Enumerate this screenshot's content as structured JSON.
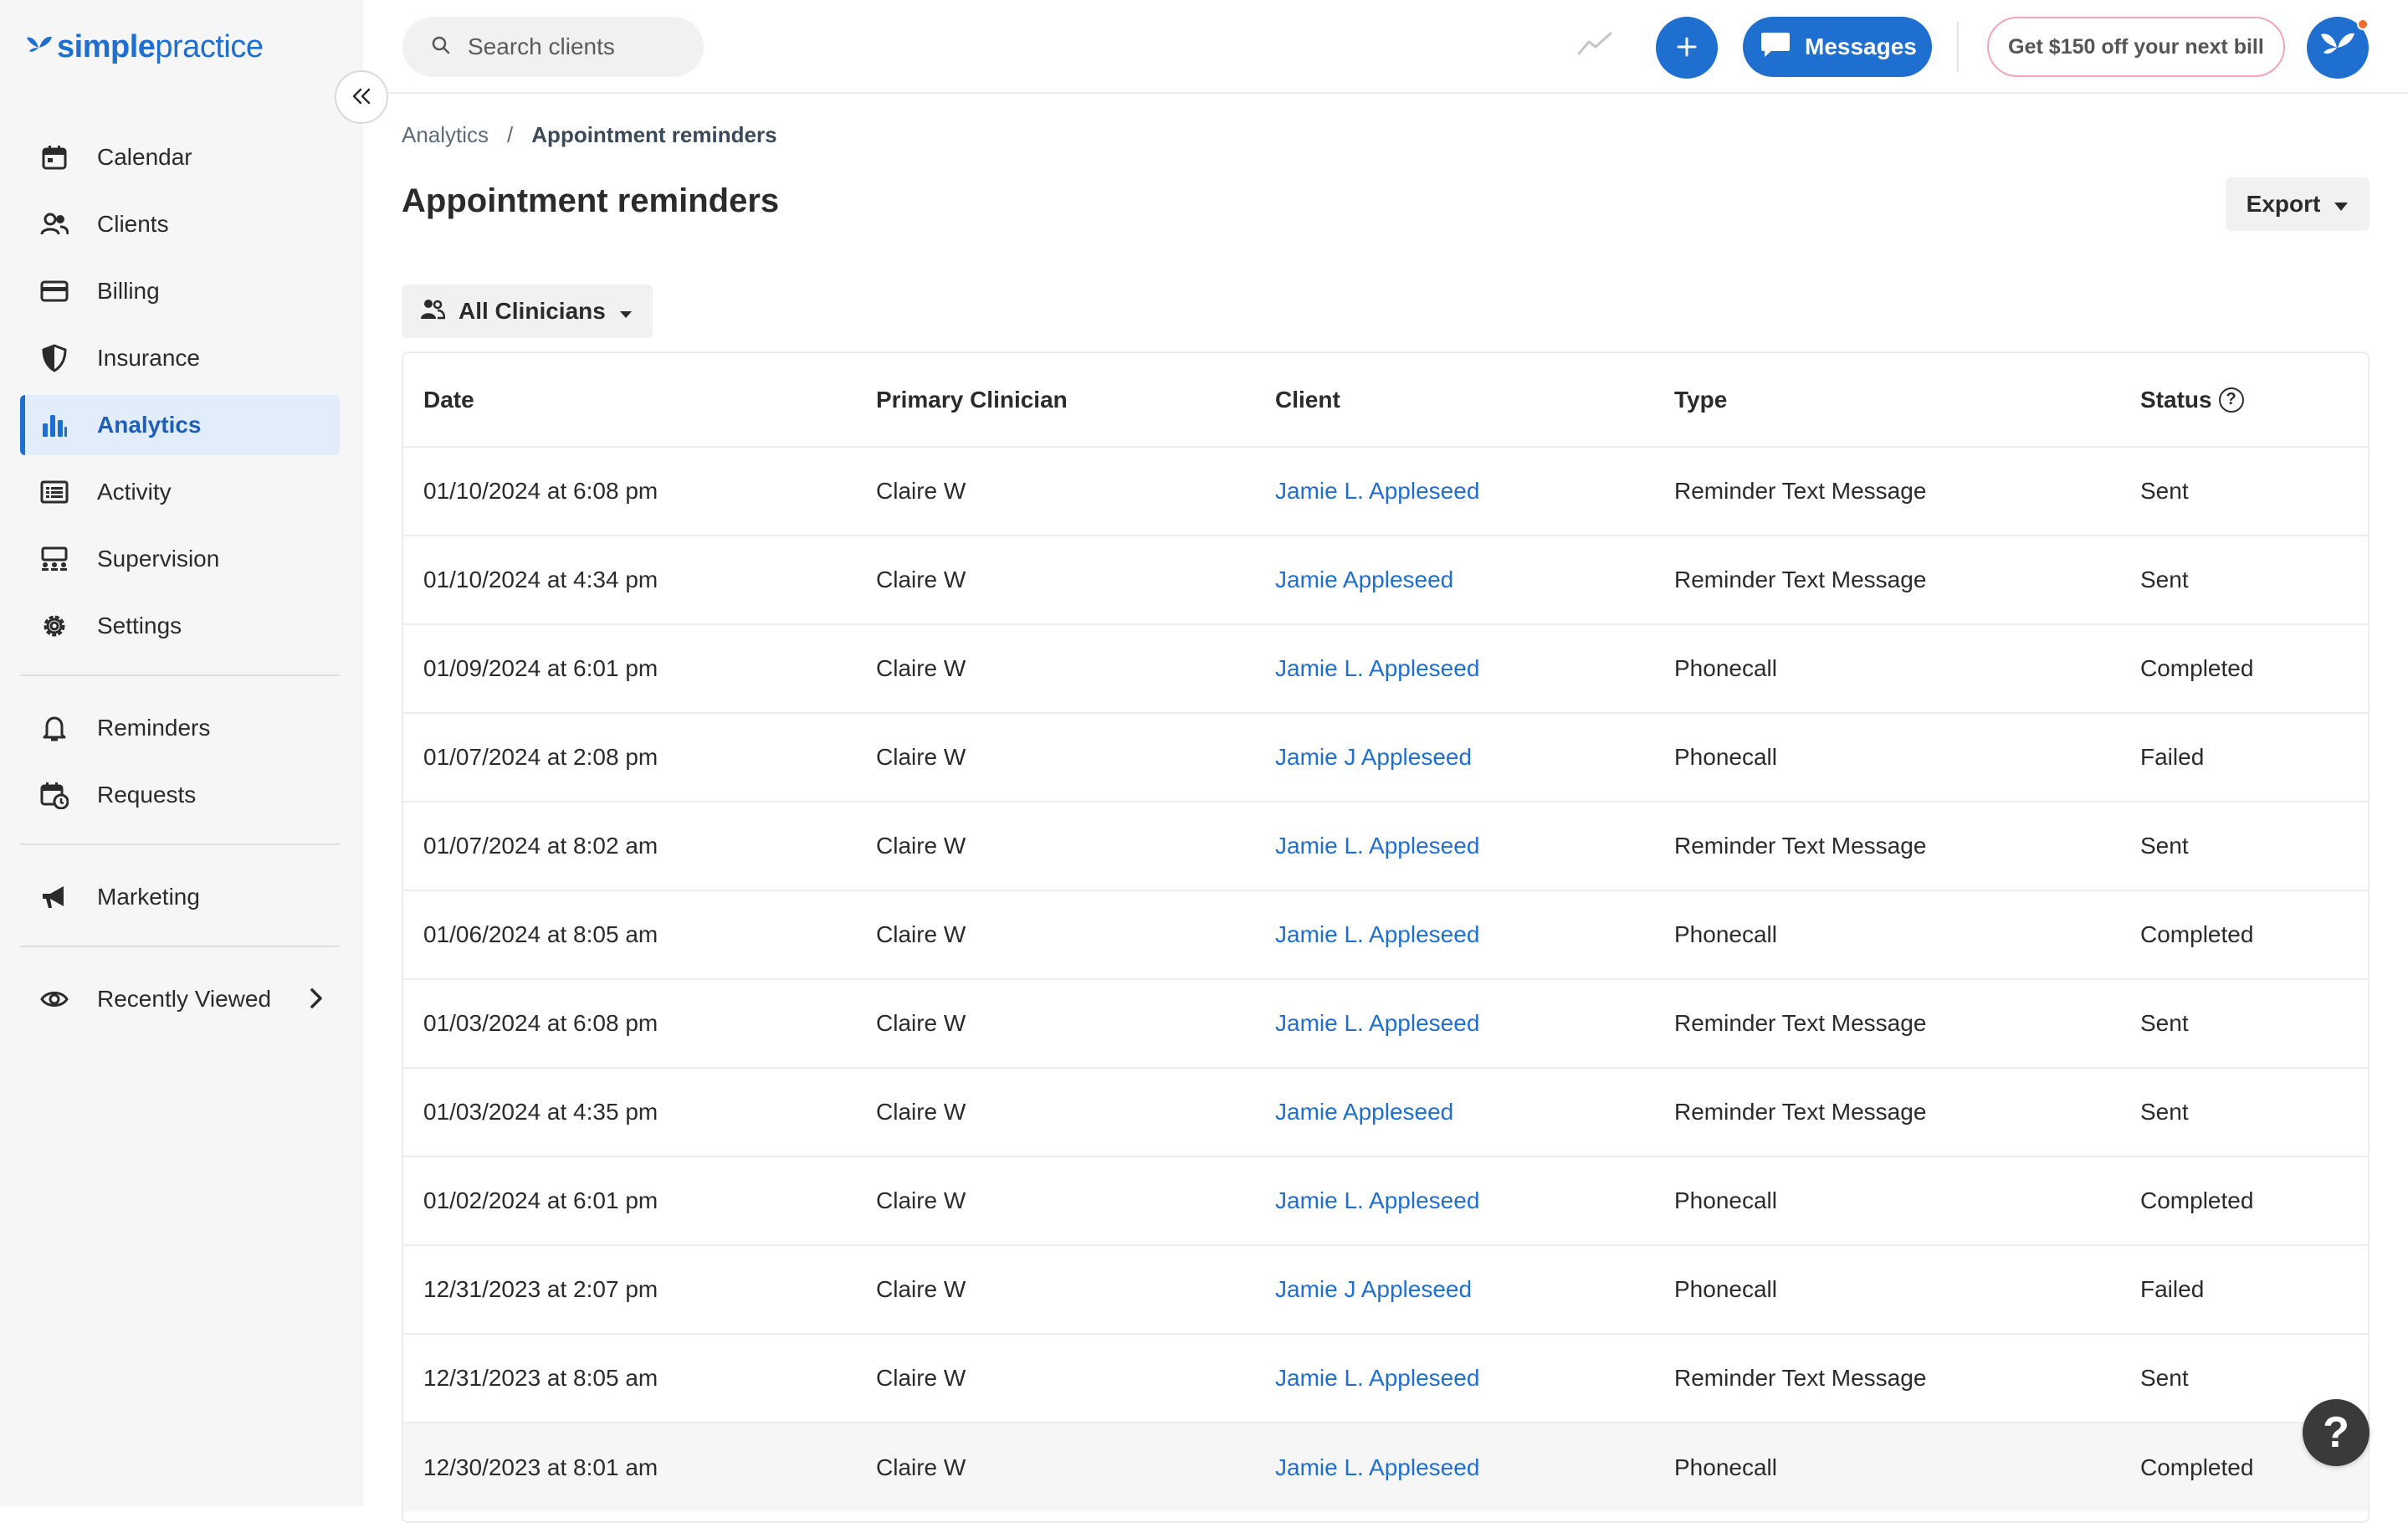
{
  "brand": {
    "simple": "simple",
    "practice": "practice"
  },
  "sidebar": {
    "items": [
      {
        "label": "Calendar",
        "icon": "calendar-icon"
      },
      {
        "label": "Clients",
        "icon": "clients-icon"
      },
      {
        "label": "Billing",
        "icon": "credit-card-icon"
      },
      {
        "label": "Insurance",
        "icon": "shield-icon"
      },
      {
        "label": "Analytics",
        "icon": "bar-chart-icon",
        "active": true
      },
      {
        "label": "Activity",
        "icon": "activity-list-icon"
      },
      {
        "label": "Supervision",
        "icon": "supervision-icon"
      },
      {
        "label": "Settings",
        "icon": "gear-icon"
      }
    ],
    "secondary": [
      {
        "label": "Reminders",
        "icon": "bell-icon"
      },
      {
        "label": "Requests",
        "icon": "calendar-request-icon"
      }
    ],
    "marketing": {
      "label": "Marketing",
      "icon": "megaphone-icon"
    },
    "recent": {
      "label": "Recently Viewed",
      "icon": "eye-icon"
    }
  },
  "topbar": {
    "search_placeholder": "Search clients",
    "messages_label": "Messages",
    "promo_label": "Get $150 off your next bill"
  },
  "breadcrumb": {
    "parent": "Analytics",
    "separator": "/",
    "current": "Appointment reminders"
  },
  "page": {
    "title": "Appointment reminders",
    "export_label": "Export",
    "filter_label": "All Clinicians"
  },
  "table": {
    "headers": {
      "date": "Date",
      "clinician": "Primary Clinician",
      "client": "Client",
      "type": "Type",
      "status": "Status"
    },
    "rows": [
      {
        "date": "01/10/2024 at 6:08 pm",
        "clinician": "Claire W",
        "client": "Jamie L. Appleseed",
        "type": "Reminder Text Message",
        "status": "Sent"
      },
      {
        "date": "01/10/2024 at 4:34 pm",
        "clinician": "Claire W",
        "client": "Jamie Appleseed",
        "type": "Reminder Text Message",
        "status": "Sent"
      },
      {
        "date": "01/09/2024 at 6:01 pm",
        "clinician": "Claire W",
        "client": "Jamie L. Appleseed",
        "type": "Phonecall",
        "status": "Completed"
      },
      {
        "date": "01/07/2024 at 2:08 pm",
        "clinician": "Claire W",
        "client": "Jamie J Appleseed",
        "type": "Phonecall",
        "status": "Failed"
      },
      {
        "date": "01/07/2024 at 8:02 am",
        "clinician": "Claire W",
        "client": "Jamie L. Appleseed",
        "type": "Reminder Text Message",
        "status": "Sent"
      },
      {
        "date": "01/06/2024 at 8:05 am",
        "clinician": "Claire W",
        "client": "Jamie L. Appleseed",
        "type": "Phonecall",
        "status": "Completed"
      },
      {
        "date": "01/03/2024 at 6:08 pm",
        "clinician": "Claire W",
        "client": "Jamie L. Appleseed",
        "type": "Reminder Text Message",
        "status": "Sent"
      },
      {
        "date": "01/03/2024 at 4:35 pm",
        "clinician": "Claire W",
        "client": "Jamie Appleseed",
        "type": "Reminder Text Message",
        "status": "Sent"
      },
      {
        "date": "01/02/2024 at 6:01 pm",
        "clinician": "Claire W",
        "client": "Jamie L. Appleseed",
        "type": "Phonecall",
        "status": "Completed"
      },
      {
        "date": "12/31/2023 at 2:07 pm",
        "clinician": "Claire W",
        "client": "Jamie J Appleseed",
        "type": "Phonecall",
        "status": "Failed"
      },
      {
        "date": "12/31/2023 at 8:05 am",
        "clinician": "Claire W",
        "client": "Jamie L. Appleseed",
        "type": "Reminder Text Message",
        "status": "Sent"
      },
      {
        "date": "12/30/2023 at 8:01 am",
        "clinician": "Claire W",
        "client": "Jamie L. Appleseed",
        "type": "Phonecall",
        "status": "Completed"
      }
    ]
  },
  "help_fab": "?",
  "colors": {
    "accent": "#1f6fd1",
    "active_bg": "#e2edfb",
    "promo_border": "#f2a5b8"
  }
}
